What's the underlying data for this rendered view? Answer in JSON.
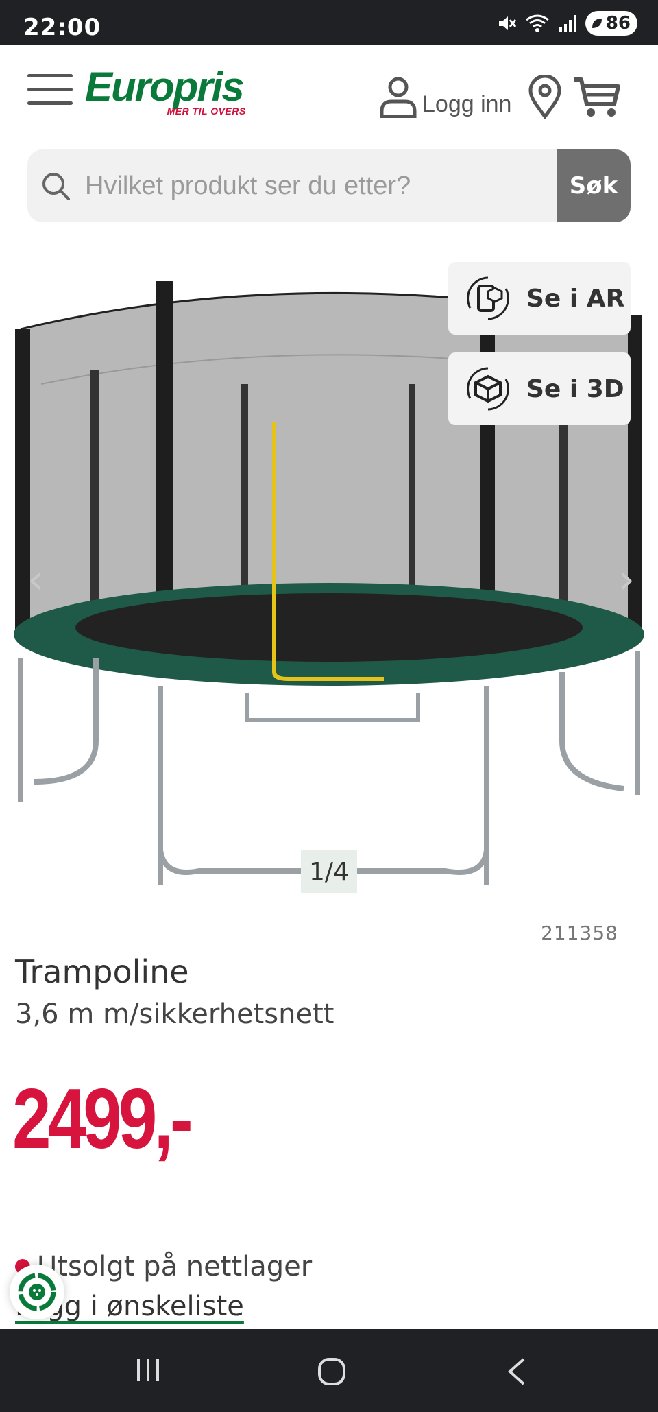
{
  "status_bar": {
    "time": "22:00",
    "battery": "86",
    "icons": [
      "mute-icon",
      "wifi-icon",
      "signal-icon",
      "battery-icon"
    ]
  },
  "header": {
    "logo_text": "Europris",
    "logo_slogan": "MER TIL OVERS",
    "login_label": "Logg inn"
  },
  "search": {
    "placeholder": "Hvilket produkt ser du etter?",
    "button_label": "Søk"
  },
  "gallery": {
    "ar_label": "Se i AR",
    "three_d_label": "Se i 3D",
    "counter": "1/4"
  },
  "product": {
    "sku": "211358",
    "title": "Trampoline",
    "subtitle": "3,6 m m/sikkerhetsnett",
    "price": "2499,-",
    "stock_status": "Utsolgt på nettlager",
    "wishlist_label": "Legg i ønskeliste"
  },
  "colors": {
    "brand_green": "#0a7a3b",
    "price_red": "#d6143d",
    "dark": "#202124"
  }
}
